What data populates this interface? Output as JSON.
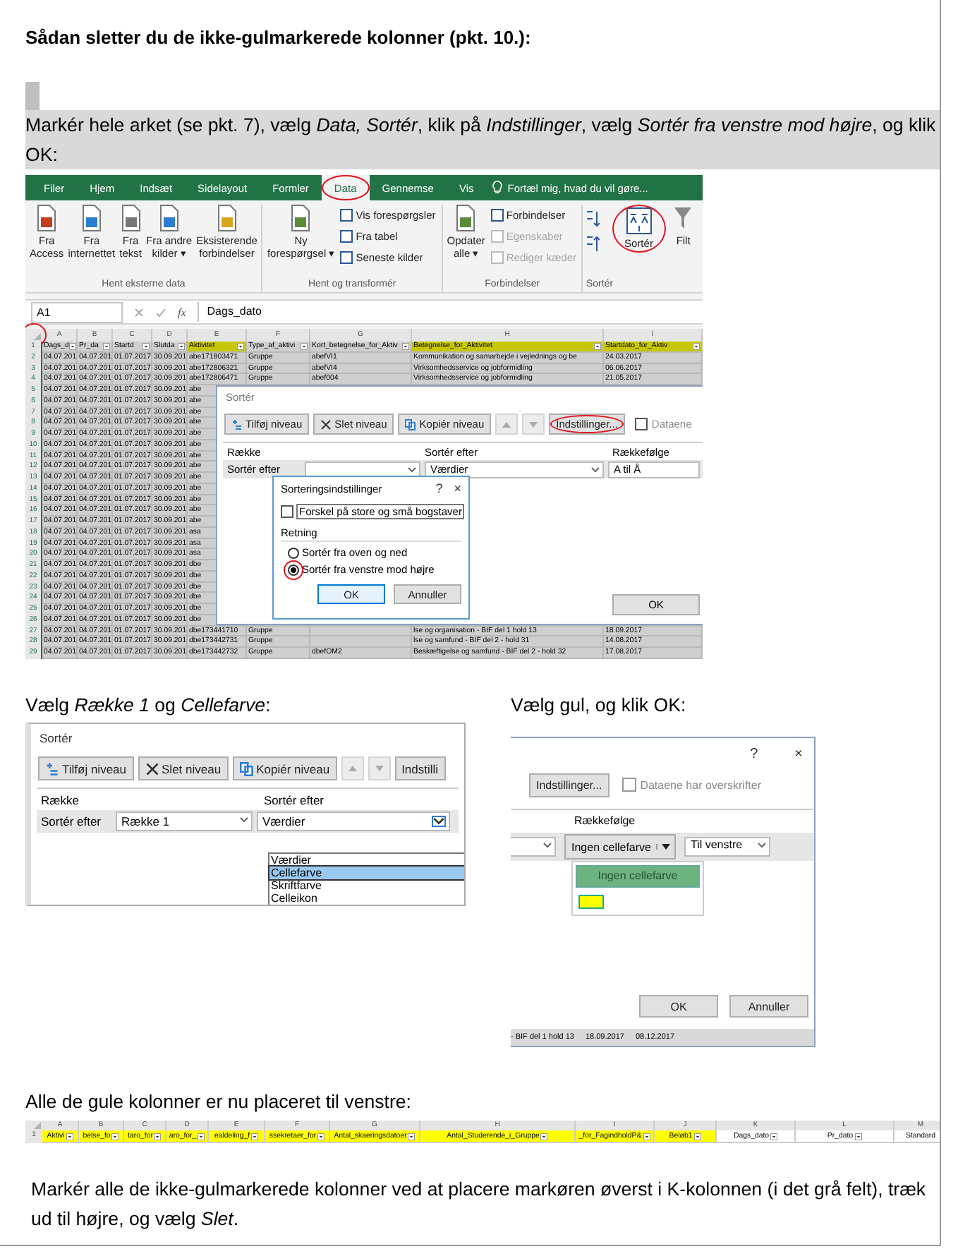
{
  "heading": "Sådan sletter du de ikke-gulmarkerede kolonner (pkt. 10.):",
  "step_1": "Markér hele arket (se pkt. 7), vælg *Data, Sortér*, klik på *Indstillinger*, vælg *Sortér fra venstre mod højre*, og klik OK:",
  "screenshot_1": {
    "tabs": [
      {
        "label": "Filer",
        "selected": false,
        "circled": false
      },
      {
        "label": "Hjem",
        "selected": false,
        "circled": false
      },
      {
        "label": "Indsæt",
        "selected": false,
        "circled": false
      },
      {
        "label": "Sidelayout",
        "selected": false,
        "circled": false
      },
      {
        "label": "Formler",
        "selected": false,
        "circled": false
      },
      {
        "label": "Data",
        "selected": true,
        "circled": true
      },
      {
        "label": "Gennemse",
        "selected": false,
        "circled": false
      },
      {
        "label": "Vis",
        "selected": false,
        "circled": false
      }
    ],
    "tell_me": "Fortæl mig, hvad du vil gøre...",
    "groups": [
      {
        "label": "Hent eksterne data",
        "buttons": [
          {
            "kind": "large",
            "lines": [
              "Fra",
              "Access"
            ],
            "circled": false
          },
          {
            "kind": "large",
            "lines": [
              "Fra",
              "internettet"
            ],
            "circled": false
          },
          {
            "kind": "large",
            "lines": [
              "Fra",
              "tekst"
            ],
            "circled": false
          },
          {
            "kind": "large",
            "lines": [
              "Fra andre",
              "kilder ▾"
            ],
            "circled": false
          },
          {
            "kind": "large",
            "lines": [
              "Eksisterende",
              "forbindelser"
            ],
            "circled": false
          }
        ]
      },
      {
        "label": "Hent og transformér",
        "buttons": [
          {
            "kind": "large",
            "lines": [
              "Ny",
              "forespørgsel ▾"
            ],
            "circled": false
          },
          {
            "kind": "small",
            "label": "Vis forespørgsler",
            "disabled": false
          },
          {
            "kind": "small",
            "label": "Fra tabel",
            "disabled": false
          },
          {
            "kind": "small",
            "label": "Seneste kilder",
            "disabled": false
          }
        ]
      },
      {
        "label": "Forbindelser",
        "buttons": [
          {
            "kind": "large",
            "lines": [
              "Opdater",
              "alle ▾"
            ],
            "circled": false
          },
          {
            "kind": "small",
            "label": "Forbindelser",
            "disabled": false
          },
          {
            "kind": "small",
            "label": "Egenskaber",
            "disabled": true
          },
          {
            "kind": "small",
            "label": "Rediger kæder",
            "disabled": true
          }
        ]
      },
      {
        "label": "Sortér",
        "buttons": [
          {
            "kind": "sort_small"
          },
          {
            "kind": "large",
            "lines": [
              "Sortér"
            ],
            "circled": true
          },
          {
            "kind": "large",
            "lines": [
              "Filt"
            ],
            "circled": false
          }
        ]
      }
    ],
    "name_box": "A1",
    "fx_label": "fx",
    "formula": "Dags_dato",
    "corner_circled": true,
    "header_row_number": "1",
    "columns": [
      {
        "letter": "A",
        "header": "Dags_d",
        "highlighted": false
      },
      {
        "letter": "B",
        "header": "Pr_da",
        "highlighted": false
      },
      {
        "letter": "C",
        "header": "Startd",
        "highlighted": false
      },
      {
        "letter": "D",
        "header": "Slutda",
        "highlighted": false
      },
      {
        "letter": "E",
        "header": "Aktivitet",
        "highlighted": true
      },
      {
        "letter": "F",
        "header": "Type_af_aktivi",
        "highlighted": false
      },
      {
        "letter": "G",
        "header": "Kort_betegnelse_for_Aktiv",
        "highlighted": false
      },
      {
        "letter": "H",
        "header": "Betegnelse_for_Aktivitet",
        "highlighted": true
      },
      {
        "letter": "I",
        "header": "Startdato_for_Aktiv",
        "highlighted": true
      }
    ],
    "rows": [
      {
        "num": "2",
        "cells": [
          "04.07.201",
          "04.07.201",
          "01.07.2017",
          "30.09.201",
          "abe171803471",
          "Gruppe",
          "abefVI1",
          "Kommunikation og samarbejde i vejlednings og be",
          "24.03.2017"
        ]
      },
      {
        "num": "3",
        "cells": [
          "04.07.201",
          "04.07.201",
          "01.07.2017",
          "30.09.201",
          "abe172806321",
          "Gruppe",
          "abefVI4",
          "Virksomhedsservice og jobformidling",
          "06.06.2017"
        ]
      },
      {
        "num": "4",
        "cells": [
          "04.07.201",
          "04.07.201",
          "01.07.2017",
          "30.09.201",
          "abe172806471",
          "Gruppe",
          "abef004",
          "Virksomhedsservice og jobformidling",
          "21.05.2017"
        ]
      },
      {
        "num": "5",
        "cells": [
          "04.07.201",
          "04.07.201",
          "01.07.2017",
          "30.09.201",
          "abe"
        ]
      },
      {
        "num": "6",
        "cells": [
          "04.07.201",
          "04.07.201",
          "01.07.2017",
          "30.09.201",
          "abe"
        ]
      },
      {
        "num": "7",
        "cells": [
          "04.07.201",
          "04.07.201",
          "01.07.2017",
          "30.09.201",
          "abe"
        ]
      },
      {
        "num": "8",
        "cells": [
          "04.07.201",
          "04.07.201",
          "01.07.2017",
          "30.09.201",
          "abe"
        ]
      },
      {
        "num": "9",
        "cells": [
          "04.07.201",
          "04.07.201",
          "01.07.2017",
          "30.09.201",
          "abe"
        ]
      },
      {
        "num": "10",
        "cells": [
          "04.07.201",
          "04.07.201",
          "01.07.2017",
          "30.09.201",
          "abe"
        ]
      },
      {
        "num": "11",
        "cells": [
          "04.07.201",
          "04.07.201",
          "01.07.2017",
          "30.09.201",
          "abe"
        ]
      },
      {
        "num": "12",
        "cells": [
          "04.07.201",
          "04.07.201",
          "01.07.2017",
          "30.09.201",
          "abe"
        ]
      },
      {
        "num": "13",
        "cells": [
          "04.07.201",
          "04.07.201",
          "01.07.2017",
          "30.09.201",
          "abe"
        ]
      },
      {
        "num": "14",
        "cells": [
          "04.07.201",
          "04.07.201",
          "01.07.2017",
          "30.09.201",
          "abe"
        ]
      },
      {
        "num": "15",
        "cells": [
          "04.07.201",
          "04.07.201",
          "01.07.2017",
          "30.09.201",
          "abe"
        ]
      },
      {
        "num": "16",
        "cells": [
          "04.07.201",
          "04.07.201",
          "01.07.2017",
          "30.09.201",
          "abe"
        ]
      },
      {
        "num": "17",
        "cells": [
          "04.07.201",
          "04.07.201",
          "01.07.2017",
          "30.09.201",
          "abe"
        ]
      },
      {
        "num": "18",
        "cells": [
          "04.07.201",
          "04.07.201",
          "01.07.2017",
          "30.09.201",
          "asa"
        ]
      },
      {
        "num": "19",
        "cells": [
          "04.07.201",
          "04.07.201",
          "01.07.2017",
          "30.09.201",
          "asa"
        ]
      },
      {
        "num": "20",
        "cells": [
          "04.07.201",
          "04.07.201",
          "01.07.2017",
          "30.09.201",
          "asa"
        ]
      },
      {
        "num": "21",
        "cells": [
          "04.07.201",
          "04.07.201",
          "01.07.2017",
          "30.09.201",
          "dbe"
        ]
      },
      {
        "num": "22",
        "cells": [
          "04.07.201",
          "04.07.201",
          "01.07.2017",
          "30.09.201",
          "dbe"
        ]
      },
      {
        "num": "23",
        "cells": [
          "04.07.201",
          "04.07.201",
          "01.07.2017",
          "30.09.201",
          "dbe"
        ]
      },
      {
        "num": "24",
        "cells": [
          "04.07.201",
          "04.07.201",
          "01.07.2017",
          "30.09.201",
          "dbe"
        ]
      },
      {
        "num": "25",
        "cells": [
          "04.07.201",
          "04.07.201",
          "01.07.2017",
          "30.09.201",
          "dbe"
        ]
      },
      {
        "num": "26",
        "cells": [
          "04.07.201",
          "04.07.201",
          "01.07.2017",
          "30.09.201",
          "dbe"
        ]
      },
      {
        "num": "27",
        "cells": [
          "04.07.201",
          "04.07.201",
          "01.07.2017",
          "30.09.201",
          "dbe173441710",
          "Gruppe",
          null,
          "lse og organisation - BIF del 1 hold 13",
          "18.09.2017"
        ]
      },
      {
        "num": "28",
        "cells": [
          "04.07.201",
          "04.07.201",
          "01.07.2017",
          "30.09.201",
          "dbe173442731",
          "Gruppe",
          null,
          "lse og samfund - BIF del 2 - hold 31",
          "14.08.2017"
        ]
      },
      {
        "num": "29",
        "cells": [
          "04.07.201",
          "04.07.201",
          "01.07.2017",
          "30.09.201",
          "dbe173442732",
          "Gruppe",
          "dbefOM2",
          "Beskæftigelse og samfund - BIF del 2 - hold 32",
          "17.08.2017"
        ]
      }
    ],
    "sort_dialog": {
      "title": "Sortér",
      "toolbar": [
        {
          "kind": "add",
          "label": "Tilføj niveau",
          "circled": false
        },
        {
          "kind": "delete",
          "label": "Slet niveau",
          "circled": false
        },
        {
          "kind": "copy",
          "label": "Kopiér niveau",
          "circled": false
        },
        {
          "kind": "up"
        },
        {
          "kind": "down"
        },
        {
          "kind": "plain",
          "label": "Indstillinger...",
          "circled": true
        }
      ],
      "checkbox": {
        "label": "Dataene",
        "checked": false
      },
      "columns": [
        "Række",
        "Sortér efter",
        "Rækkefølge"
      ],
      "row": {
        "label": "Sortér efter",
        "sort_on": "Værdier",
        "order": "A til Å"
      },
      "ok": "OK"
    },
    "options_dialog": {
      "title": "Sorteringsindstillinger",
      "help": "?",
      "close": "×",
      "case_checkbox": {
        "label": "Forskel på store og små bogstaver",
        "checked": false
      },
      "direction_label": "Retning",
      "radios": [
        {
          "label": "Sortér fra oven og ned",
          "selected": false,
          "circled": false
        },
        {
          "label": "Sortér fra venstre mod højre",
          "selected": true,
          "circled": true
        }
      ],
      "buttons": [
        "OK",
        "Annuller"
      ]
    }
  },
  "step_2": "Vælg *Række 1* og *Cellefarve*:",
  "screenshot_2": {
    "title": "Sortér",
    "toolbar": [
      {
        "kind": "add",
        "label": "Tilføj niveau"
      },
      {
        "kind": "delete",
        "label": "Slet niveau"
      },
      {
        "kind": "copy",
        "label": "Kopiér niveau"
      },
      {
        "kind": "up"
      },
      {
        "kind": "down"
      },
      {
        "kind": "plain",
        "label": "Indstilli"
      }
    ],
    "columns": [
      "Række",
      "Sortér efter"
    ],
    "row": {
      "label": "Sortér efter",
      "column": "Række 1",
      "sort_on": "Værdier"
    },
    "options": [
      {
        "label": "Værdier",
        "selected": false
      },
      {
        "label": "Cellefarve",
        "selected": true
      },
      {
        "label": "Skriftfarve",
        "selected": false
      },
      {
        "label": "Celleikon",
        "selected": false
      }
    ]
  },
  "step_3": "Vælg gul, og klik OK:",
  "screenshot_3": {
    "help": "?",
    "close": "×",
    "options_button": "Indstillinger...",
    "checkbox": {
      "label": "Dataene har overskrifter",
      "checked": false
    },
    "column": "Rækkefølge",
    "order": "Ingen cellefarve",
    "position": "Til venstre",
    "colors": [
      {
        "kind": "none",
        "label": "Ingen cellefarve",
        "selected": true
      },
      {
        "kind": "swatch",
        "color": "#ffff00",
        "selected": false
      }
    ],
    "buttons": [
      "OK",
      "Annuller"
    ],
    "background_cells": [
      "- BIF del 1 hold 13",
      "18.09.2017",
      "08.12.2017"
    ]
  },
  "step_4": "Alle de gule kolonner er nu placeret til venstre:",
  "strip": {
    "row_number": "1",
    "columns": [
      {
        "letter": "A",
        "header": "Aktivi",
        "highlighted": true,
        "filter": true
      },
      {
        "letter": "B",
        "header": "belse_fo",
        "highlighted": true,
        "filter": true
      },
      {
        "letter": "C",
        "header": "taro_for",
        "highlighted": true,
        "filter": true
      },
      {
        "letter": "D",
        "header": "aro_for_",
        "highlighted": true,
        "filter": true
      },
      {
        "letter": "E",
        "header": "ealdeling_f",
        "highlighted": true,
        "filter": true
      },
      {
        "letter": "F",
        "header": "ssekretaer_for",
        "highlighted": true,
        "filter": true
      },
      {
        "letter": "G",
        "header": "Antal_skaeringsdatoer",
        "highlighted": true,
        "filter": true
      },
      {
        "letter": "H",
        "header": "Antal_Studerende_i_Gruppe",
        "highlighted": true,
        "filter": true
      },
      {
        "letter": "I",
        "header": "_for_FagindholdP&",
        "highlighted": true,
        "filter": true
      },
      {
        "letter": "J",
        "header": "Beløb1",
        "highlighted": true,
        "filter": true
      },
      {
        "letter": "K",
        "header": "Dags_dato",
        "highlighted": false,
        "filter": true
      },
      {
        "letter": "L",
        "header": "Pr_dato",
        "highlighted": false,
        "filter": true
      },
      {
        "letter": "M",
        "header": "Standard",
        "highlighted": false,
        "filter": false
      }
    ]
  },
  "step_5": "Markér alle de ikke-gulmarkerede kolonner ved at placere markøren øverst i K-kolonnen (i det grå felt), træk ud til højre, og vælg *Slet*."
}
